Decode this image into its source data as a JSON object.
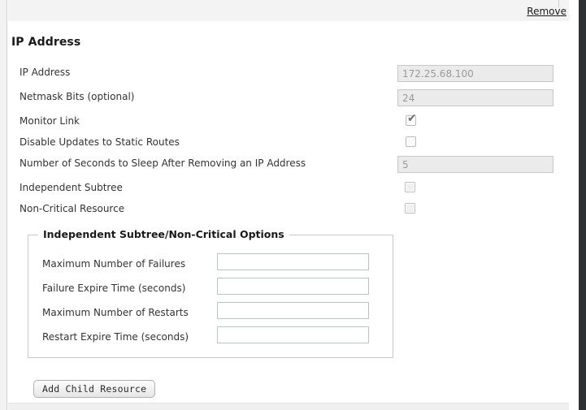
{
  "resource_header": {
    "remove_label": "Remove"
  },
  "section": {
    "title": "IP Address"
  },
  "form": {
    "rows": [
      {
        "label": "IP Address",
        "type": "text",
        "value": "172.25.68.100",
        "disabled": true
      },
      {
        "label": "Netmask Bits (optional)",
        "type": "text",
        "value": "24",
        "disabled": true
      },
      {
        "label": "Monitor Link",
        "type": "checkbox",
        "checked": true
      },
      {
        "label": "Disable Updates to Static Routes",
        "type": "checkbox",
        "checked": false
      },
      {
        "label": "Number of Seconds to Sleep After Removing an IP Address",
        "type": "text",
        "value": "5",
        "disabled": true
      },
      {
        "label": "Independent Subtree",
        "type": "checkbox",
        "checked": false
      },
      {
        "label": "Non-Critical Resource",
        "type": "checkbox",
        "checked": false
      }
    ],
    "labels": {
      "ip_address": "IP Address",
      "netmask_bits": "Netmask Bits (optional)",
      "monitor_link": "Monitor Link",
      "disable_updates": "Disable Updates to Static Routes",
      "sleep_seconds": "Number of Seconds to Sleep After Removing an IP Address",
      "independent_subtree": "Independent Subtree",
      "non_critical_resource": "Non-Critical Resource"
    },
    "values": {
      "ip_address": "172.25.68.100",
      "netmask_bits": "24",
      "sleep_seconds": "5"
    },
    "checkmark_glyph": "✔"
  },
  "fieldset": {
    "legend": "Independent Subtree/Non-Critical Options",
    "rows": [
      {
        "label": "Maximum Number of Failures",
        "value": ""
      },
      {
        "label": "Failure Expire Time (seconds)",
        "value": ""
      },
      {
        "label": "Maximum Number of Restarts",
        "value": ""
      },
      {
        "label": "Restart Expire Time (seconds)",
        "value": ""
      }
    ],
    "labels": {
      "max_failures": "Maximum Number of Failures",
      "failure_expire": "Failure Expire Time (seconds)",
      "max_restarts": "Maximum Number of Restarts",
      "restart_expire": "Restart Expire Time (seconds)"
    }
  },
  "actions": {
    "add_child_resource": "Add Child Resource"
  },
  "colors": {
    "panel_bg": "#ffffff",
    "header_band": "#f3f3f3",
    "disabled_input_bg": "#ebebeb",
    "disabled_input_text": "#9a9a9a",
    "input_border": "#bdc4c7",
    "window_edge": "#2e3033",
    "link_text": "#1a1a1a"
  }
}
